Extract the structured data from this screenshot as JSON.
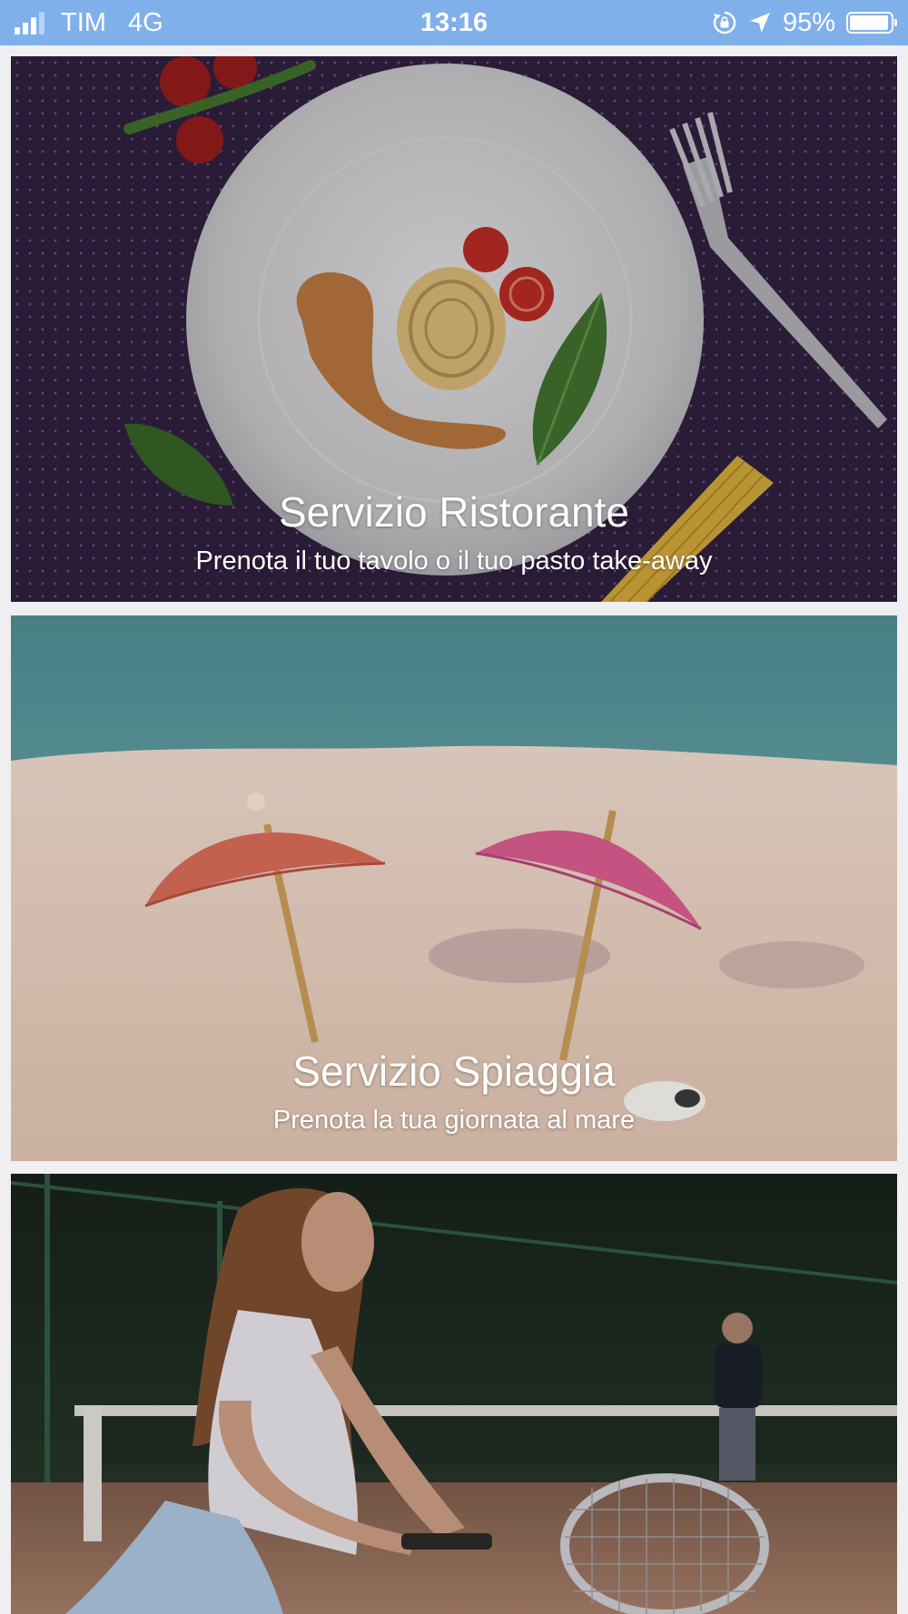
{
  "status_bar": {
    "carrier": "TIM",
    "network": "4G",
    "time": "13:16",
    "battery_percent": "95%",
    "battery_level": 0.95,
    "icons": [
      "signal-icon",
      "orientation-lock-icon",
      "location-arrow-icon",
      "battery-icon"
    ],
    "background_color": "#7fb0ea"
  },
  "services": [
    {
      "title": "Servizio Ristorante",
      "subtitle": "Prenota il tuo tavolo o il tuo pasto take-away",
      "image": "plate-of-spaghetti-image"
    },
    {
      "title": "Servizio Spiaggia",
      "subtitle": "Prenota la tua giornata al mare",
      "image": "beach-umbrellas-image"
    },
    {
      "title": "",
      "subtitle": "",
      "image": "tennis-player-image"
    }
  ]
}
